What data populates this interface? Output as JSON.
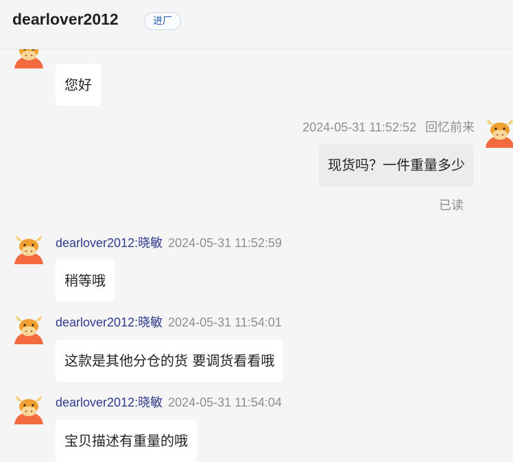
{
  "header": {
    "title": "dearlover2012",
    "badge": "进厂"
  },
  "messages": [
    {
      "side": "left",
      "text": "您好"
    },
    {
      "side": "right",
      "sender": "回忆前来",
      "time": "2024-05-31 11:52:52",
      "text": "现货吗？一件重量多少",
      "status": "已读"
    },
    {
      "side": "left",
      "sender": "dearlover2012:晓敏",
      "time": "2024-05-31 11:52:59",
      "text": "稍等哦"
    },
    {
      "side": "left",
      "sender": "dearlover2012:晓敏",
      "time": "2024-05-31 11:54:01",
      "text": "这款是其他分仓的货 要调货看看哦"
    },
    {
      "side": "left",
      "sender": "dearlover2012:晓敏",
      "time": "2024-05-31 11:54:04",
      "text": "宝贝描述有重量的哦"
    }
  ],
  "colors": {
    "background": "#f5f5f5",
    "sender": "#2e3a8c",
    "timestamp": "#8e8e8e",
    "bubble_other": "#ffffff",
    "bubble_mine": "#ececec",
    "avatar": "#f26a3d"
  },
  "icons": {
    "avatar": "cartoon-bull-avatar-icon"
  }
}
